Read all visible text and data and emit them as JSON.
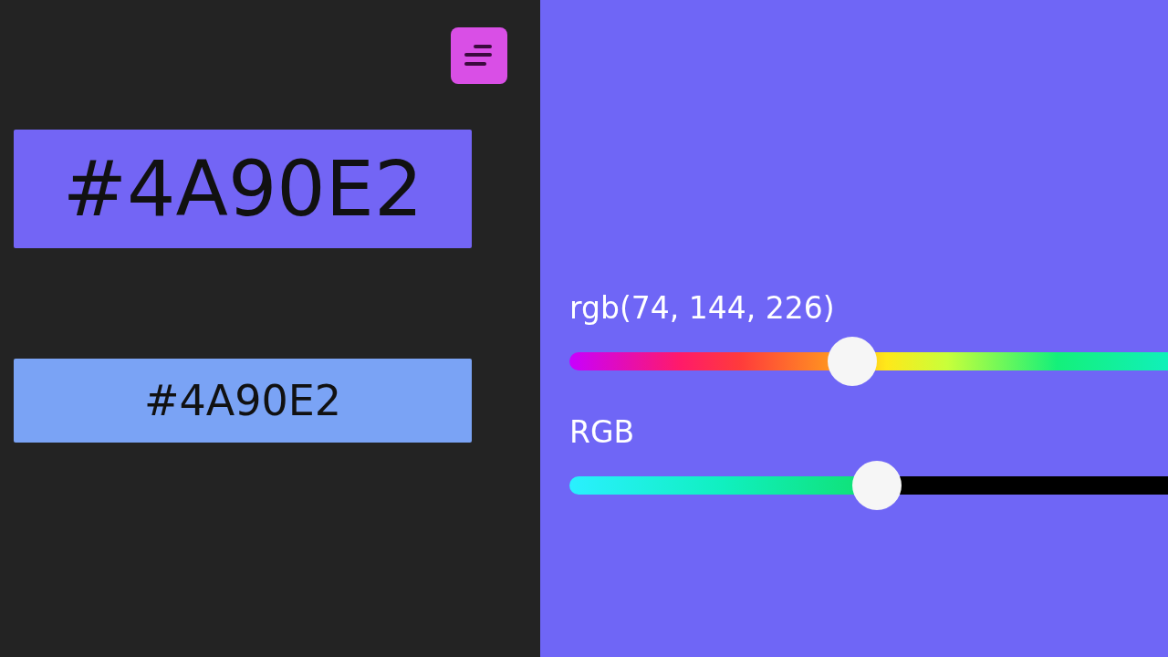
{
  "hex_display": {
    "text": "#4A90E2"
  },
  "hex_field": {
    "value": "#4A90E2"
  },
  "sliders": [
    {
      "label": "rgb(74, 144, 226)",
      "kind": "hue",
      "level": 0.47
    },
    {
      "label": "RGB",
      "kind": "channel",
      "level": 0.515
    }
  ]
}
